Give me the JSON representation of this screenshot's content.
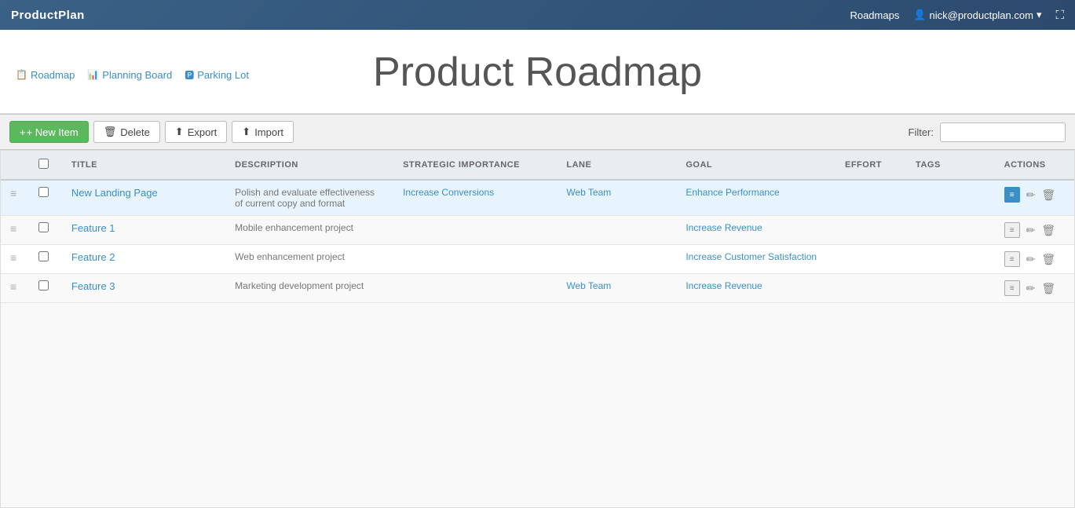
{
  "brand": "ProductPlan",
  "topnav": {
    "roadmaps_label": "Roadmaps",
    "user_email": "nick@productplan.com",
    "expand_icon": "⛶"
  },
  "subnav": {
    "roadmap_label": "Roadmap",
    "planning_board_label": "Planning Board",
    "parking_lot_label": "Parking Lot"
  },
  "page_title": "Product Roadmap",
  "toolbar": {
    "new_item_label": "+ New Item",
    "delete_label": "Delete",
    "export_label": "Export",
    "import_label": "Import",
    "filter_label": "Filter:",
    "filter_placeholder": ""
  },
  "table": {
    "columns": [
      "",
      "",
      "TITLE",
      "DESCRIPTION",
      "STRATEGIC IMPORTANCE",
      "LANE",
      "GOAL",
      "EFFORT",
      "TAGS",
      "ACTIONS"
    ],
    "rows": [
      {
        "id": 1,
        "title": "New Landing Page",
        "description": "Polish and evaluate effectiveness of current copy and format",
        "strategic_importance": "Increase Conversions",
        "lane": "Web Team",
        "goal": "Enhance Performance",
        "effort": "",
        "tags": "",
        "highlighted": true
      },
      {
        "id": 2,
        "title": "Feature 1",
        "description": "Mobile enhancement project",
        "strategic_importance": "",
        "lane": "",
        "goal": "Increase Revenue",
        "effort": "",
        "tags": "",
        "highlighted": false
      },
      {
        "id": 3,
        "title": "Feature 2",
        "description": "Web enhancement project",
        "strategic_importance": "",
        "lane": "",
        "goal": "Increase Customer Satisfaction",
        "effort": "",
        "tags": "",
        "highlighted": false
      },
      {
        "id": 4,
        "title": "Feature 3",
        "description": "Marketing development project",
        "strategic_importance": "",
        "lane": "Web Team",
        "goal": "Increase Revenue",
        "effort": "",
        "tags": "",
        "highlighted": false
      }
    ]
  }
}
